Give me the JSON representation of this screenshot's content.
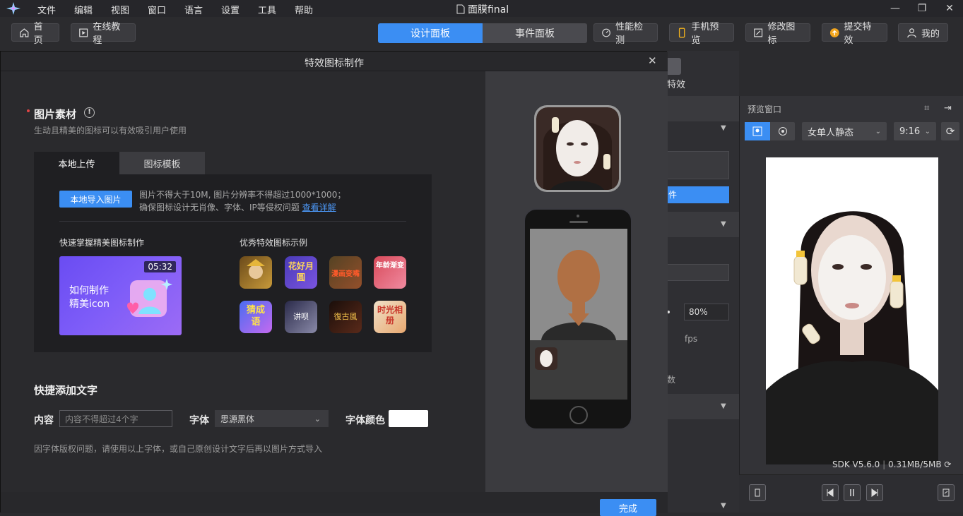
{
  "menu": {
    "items": [
      "文件",
      "编辑",
      "视图",
      "窗口",
      "语言",
      "设置",
      "工具",
      "帮助"
    ],
    "doc_title": "面膜final"
  },
  "toolbar": {
    "home": "首页",
    "tutorial": "在线教程",
    "tab_design": "设计面板",
    "tab_event": "事件面板",
    "perf": "性能检测",
    "phone_preview": "手机预览",
    "edit_icon": "修改图标",
    "submit": "提交特效",
    "mine": "我的"
  },
  "background": {
    "label_effect": "特效",
    "btn_partial": "件",
    "percent": "80%",
    "fps": "fps",
    "suffix": "数"
  },
  "dialog": {
    "title": "特效图标制作",
    "section_title": "图片素材",
    "section_sub": "生动且精美的图标可以有效吸引用户使用",
    "tab_local": "本地上传",
    "tab_template": "图标模板",
    "upload_btn": "本地导入图片",
    "note_line1": "图片不得大于10M, 图片分辨率不得超过1000*1000；",
    "note_line2": "确保图标设计无肖像、字体、IP等侵权问题",
    "note_link": "查看详解",
    "learn_title": "快速掌握精美图标制作",
    "video_time": "05:32",
    "video_text_1": "如何制作",
    "video_text_2": "精美icon",
    "examples_title": "优秀特效图标示例",
    "example_texts": [
      "",
      "花好月圆",
      "漫画变嘴",
      "年龄渐变",
      "猜成语",
      "讲呗",
      "復古風",
      "时光相册"
    ],
    "quick_text_title": "快捷添加文字",
    "content_label": "内容",
    "content_placeholder": "内容不得超过4个字",
    "font_label": "字体",
    "font_value": "思源黑体",
    "color_label": "字体颜色",
    "color_value": "#ffffff",
    "hint": "因字体版权问题，请使用以上字体，或自己原创设计文字后再以图片方式导入",
    "done_btn": "完成"
  },
  "preview": {
    "title": "预览窗口",
    "model": "女单人静态",
    "ratio": "9:16",
    "sdk": "SDK V5.6.0",
    "size": "0.31MB/5MB"
  },
  "colors": {
    "accent": "#3b8ef3",
    "bg": "#2b2b2e",
    "required_dot": "#e04545"
  }
}
